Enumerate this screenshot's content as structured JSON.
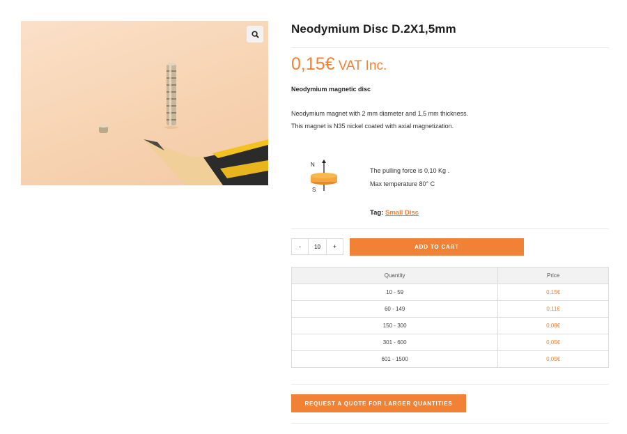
{
  "product": {
    "title": "Neodymium Disc D.2X1,5mm",
    "price": "0,15€",
    "price_suffix": "VAT Inc.",
    "subtitle": "Neodymium magnetic disc",
    "description_line1": "Neodymium magnet with 2 mm diameter and 1,5 mm thickness.",
    "description_line2": "This magnet is N35 nickel coated with axial magnetization.",
    "pull_force": "The pulling force is 0,10 Kg .",
    "max_temp": "Max temperature 80° C",
    "tag_label": "Tag:",
    "tag_value": "Small Disc"
  },
  "icons": {
    "zoom": "search-icon",
    "diagram": "magnet-poles-diagram"
  },
  "diagram": {
    "north_label": "N",
    "south_label": "S"
  },
  "cart": {
    "decrement_label": "-",
    "quantity": "10",
    "increment_label": "+",
    "add_to_cart_label": "ADD TO CART"
  },
  "pricing_table": {
    "headers": [
      "Quantity",
      "Price"
    ],
    "rows": [
      {
        "quantity": "10 - 59",
        "price": "0,15€"
      },
      {
        "quantity": "60 - 149",
        "price": "0,11€"
      },
      {
        "quantity": "150 - 300",
        "price": "0,08€"
      },
      {
        "quantity": "301 - 600",
        "price": "0,05€"
      },
      {
        "quantity": "601 - 1500",
        "price": "0,05€"
      }
    ]
  },
  "quote_button_label": "REQUEST A QUOTE FOR LARGER QUANTITIES",
  "colors": {
    "accent": "#f08135",
    "border": "#dcdcdc",
    "header_bg": "#f2f2f2"
  }
}
